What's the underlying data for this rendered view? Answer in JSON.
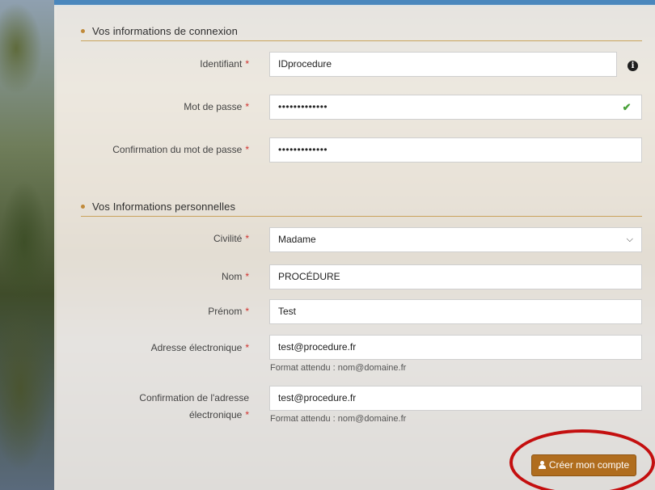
{
  "sections": {
    "connexion": {
      "title": "Vos informations de connexion"
    },
    "personnelles": {
      "title": "Vos Informations personnelles"
    }
  },
  "required_marker": "*",
  "fields": {
    "identifiant": {
      "label": "Identifiant",
      "value": "IDprocedure"
    },
    "mot_de_passe": {
      "label": "Mot de passe",
      "value": "•••••••••••••"
    },
    "confirmation_mot_de_passe": {
      "label": "Confirmation du mot de passe",
      "value": "•••••••••••••"
    },
    "civilite": {
      "label": "Civilité",
      "value": "Madame"
    },
    "nom": {
      "label": "Nom",
      "value": "PROCÉDURE"
    },
    "prenom": {
      "label": "Prénom",
      "value": "Test"
    },
    "adresse": {
      "label": "Adresse électronique",
      "value": "test@procedure.fr",
      "hint": "Format attendu : nom@domaine.fr"
    },
    "confirmation_adresse": {
      "label_line1": "Confirmation de l'adresse",
      "label_line2": "électronique",
      "value": "test@procedure.fr",
      "hint": "Format attendu : nom@domaine.fr"
    }
  },
  "icons": {
    "info": "i",
    "check": "✔",
    "chevron": "⌄"
  },
  "buttons": {
    "create_account": {
      "label": "Créer mon compte",
      "icon": "user-icon"
    }
  },
  "colors": {
    "accent_button": "#b06d1e",
    "required": "#d0312d",
    "section_line": "#c9a35c",
    "highlight": "#c40f0f",
    "topbar": "#4a87bd"
  }
}
